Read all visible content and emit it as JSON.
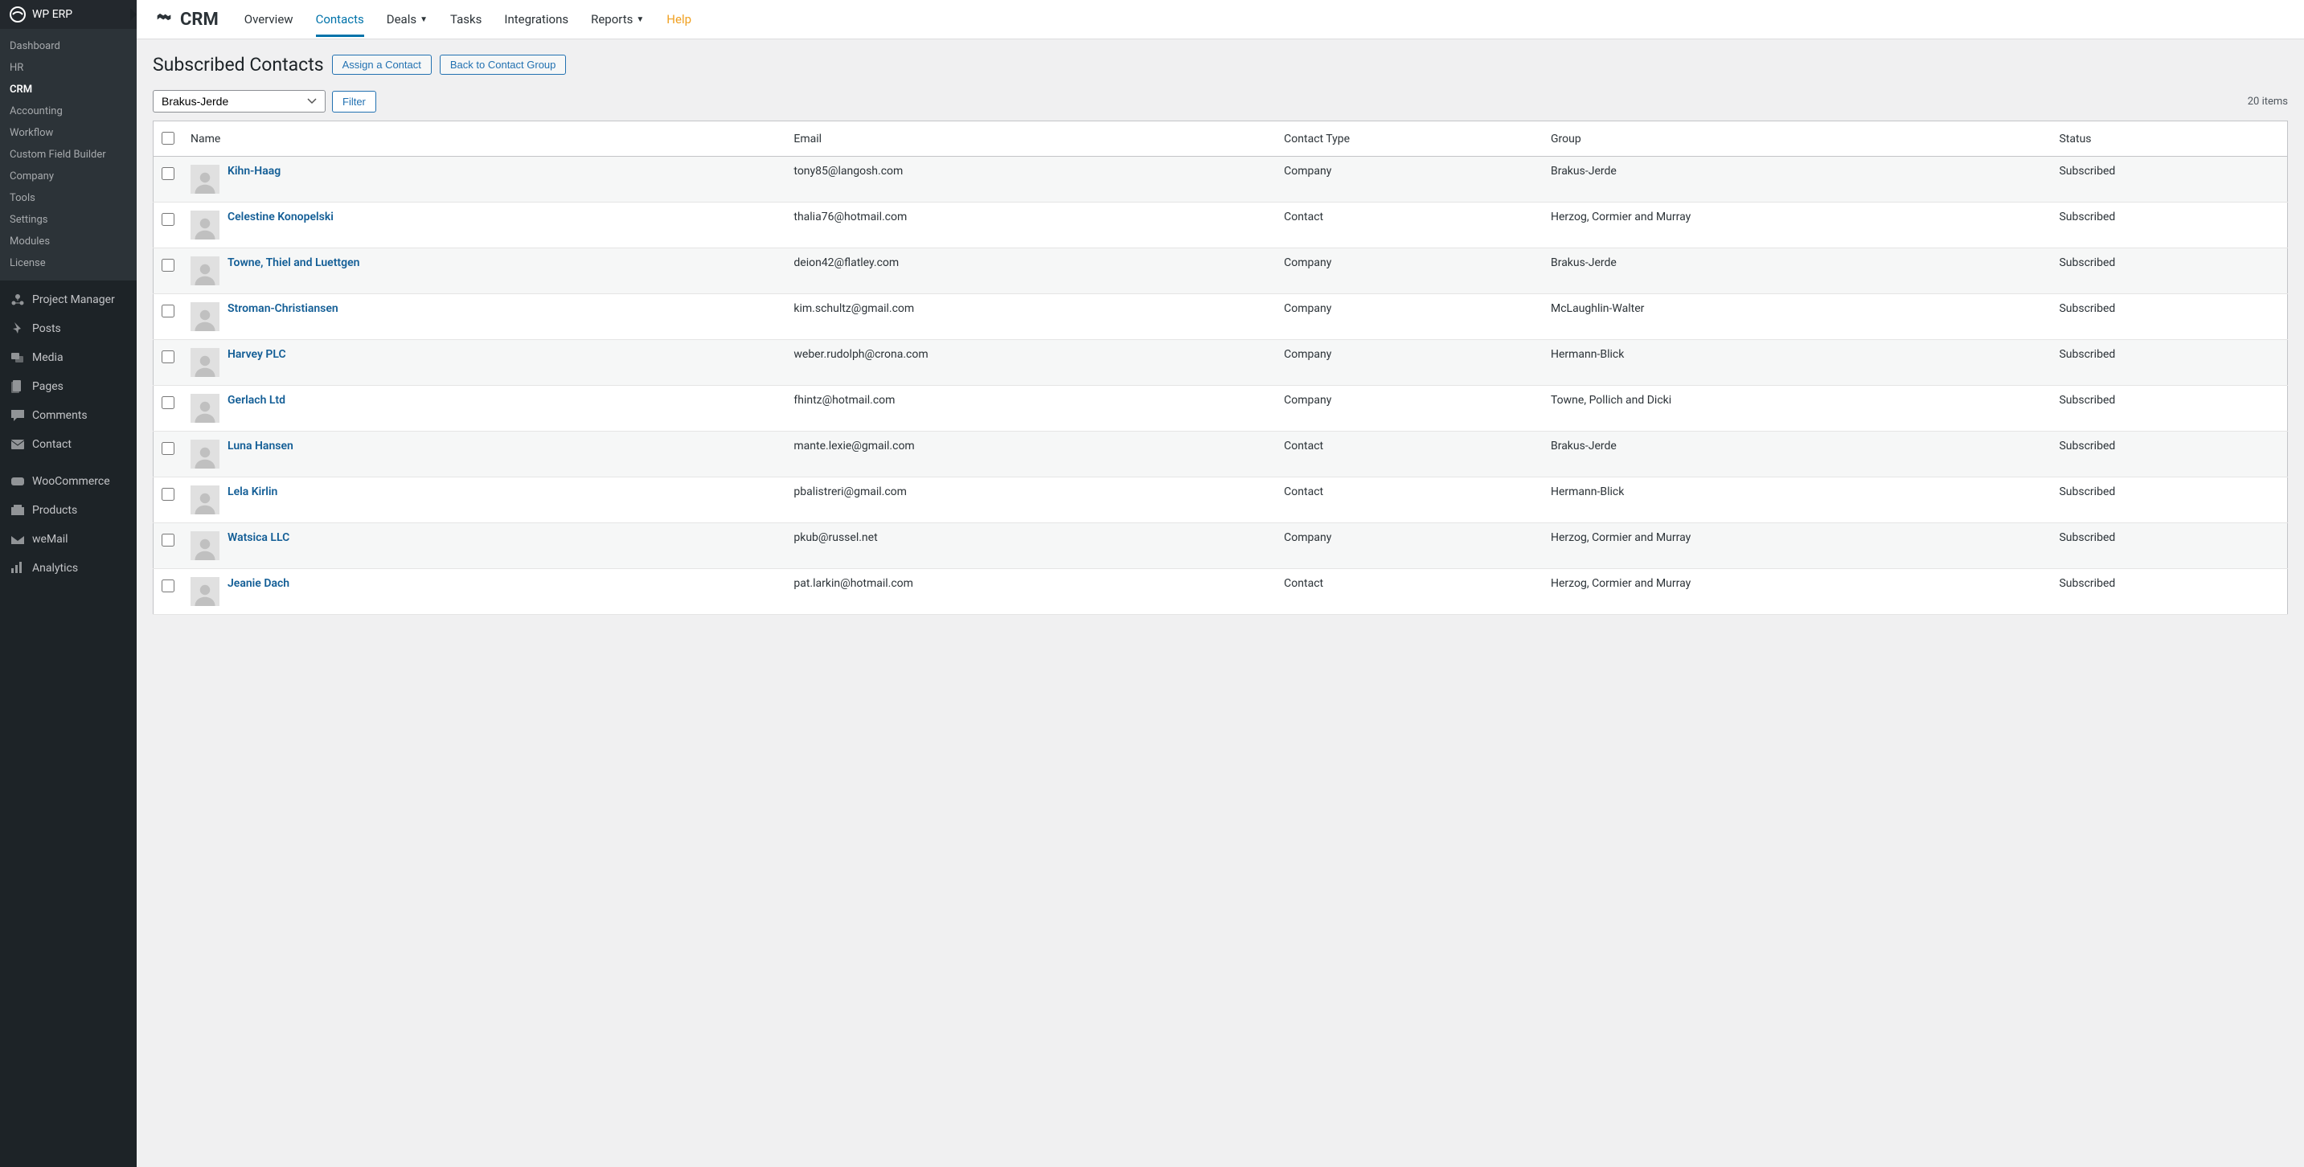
{
  "sidebar": {
    "brand": "WP ERP",
    "submenu": [
      "Dashboard",
      "HR",
      "CRM",
      "Accounting",
      "Workflow",
      "Custom Field Builder",
      "Company",
      "Tools",
      "Settings",
      "Modules",
      "License"
    ],
    "submenu_active": "CRM",
    "menu": [
      {
        "label": "Project Manager",
        "icon": "project"
      },
      {
        "label": "Posts",
        "icon": "pin"
      },
      {
        "label": "Media",
        "icon": "media"
      },
      {
        "label": "Pages",
        "icon": "page"
      },
      {
        "label": "Comments",
        "icon": "comment"
      },
      {
        "label": "Contact",
        "icon": "mail"
      },
      {
        "label": "WooCommerce",
        "icon": "woo"
      },
      {
        "label": "Products",
        "icon": "products"
      },
      {
        "label": "weMail",
        "icon": "wemail"
      },
      {
        "label": "Analytics",
        "icon": "analytics"
      }
    ]
  },
  "topbar": {
    "brand": "CRM",
    "nav": [
      {
        "label": "Overview"
      },
      {
        "label": "Contacts",
        "active": true
      },
      {
        "label": "Deals",
        "dropdown": true
      },
      {
        "label": "Tasks"
      },
      {
        "label": "Integrations"
      },
      {
        "label": "Reports",
        "dropdown": true
      },
      {
        "label": "Help",
        "help": true
      }
    ]
  },
  "page": {
    "title": "Subscribed Contacts",
    "assign_btn": "Assign a Contact",
    "back_btn": "Back to Contact Group",
    "group_filter": "Brakus-Jerde",
    "filter_btn": "Filter",
    "item_count": "20 items"
  },
  "table": {
    "columns": [
      "Name",
      "Email",
      "Contact Type",
      "Group",
      "Status"
    ],
    "rows": [
      {
        "name": "Kihn-Haag",
        "email": "tony85@langosh.com",
        "type": "Company",
        "group": "Brakus-Jerde",
        "status": "Subscribed"
      },
      {
        "name": "Celestine Konopelski",
        "email": "thalia76@hotmail.com",
        "type": "Contact",
        "group": "Herzog, Cormier and Murray",
        "status": "Subscribed"
      },
      {
        "name": "Towne, Thiel and Luettgen",
        "email": "deion42@flatley.com",
        "type": "Company",
        "group": "Brakus-Jerde",
        "status": "Subscribed"
      },
      {
        "name": "Stroman-Christiansen",
        "email": "kim.schultz@gmail.com",
        "type": "Company",
        "group": "McLaughlin-Walter",
        "status": "Subscribed"
      },
      {
        "name": "Harvey PLC",
        "email": "weber.rudolph@crona.com",
        "type": "Company",
        "group": "Hermann-Blick",
        "status": "Subscribed"
      },
      {
        "name": "Gerlach Ltd",
        "email": "fhintz@hotmail.com",
        "type": "Company",
        "group": "Towne, Pollich and Dicki",
        "status": "Subscribed"
      },
      {
        "name": "Luna Hansen",
        "email": "mante.lexie@gmail.com",
        "type": "Contact",
        "group": "Brakus-Jerde",
        "status": "Subscribed"
      },
      {
        "name": "Lela Kirlin",
        "email": "pbalistreri@gmail.com",
        "type": "Contact",
        "group": "Hermann-Blick",
        "status": "Subscribed"
      },
      {
        "name": "Watsica LLC",
        "email": "pkub@russel.net",
        "type": "Company",
        "group": "Herzog, Cormier and Murray",
        "status": "Subscribed"
      },
      {
        "name": "Jeanie Dach",
        "email": "pat.larkin@hotmail.com",
        "type": "Contact",
        "group": "Herzog, Cormier and Murray",
        "status": "Subscribed"
      }
    ]
  }
}
